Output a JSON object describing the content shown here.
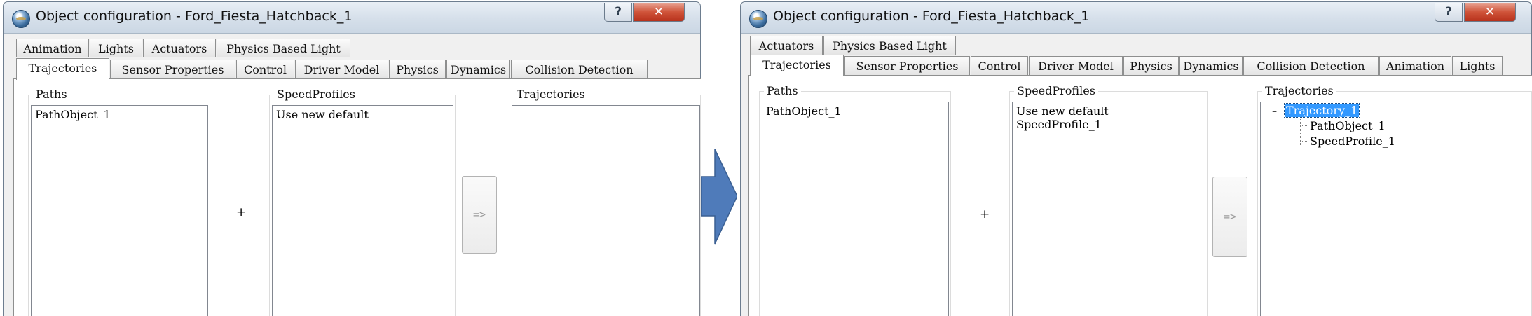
{
  "left": {
    "window_title": "Object configuration - Ford_Fiesta_Hatchback_1",
    "help_label": "?",
    "close_label": "✕",
    "tab_row_1": [
      "Animation",
      "Lights",
      "Actuators",
      "Physics Based Light"
    ],
    "tab_row_2": [
      "Trajectories",
      "Sensor Properties",
      "Control",
      "Driver Model",
      "Physics",
      "Dynamics",
      "Collision Detection"
    ],
    "paths": {
      "label": "Paths",
      "items": [
        "PathObject_1"
      ]
    },
    "speed_profiles": {
      "label": "SpeedProfiles",
      "items": [
        "Use new default"
      ]
    },
    "plus": "+",
    "assign_button": "=>",
    "trajectories": {
      "label": "Trajectories"
    }
  },
  "arrow_color": "#4f7bba",
  "right": {
    "window_title": "Object configuration - Ford_Fiesta_Hatchback_1",
    "help_label": "?",
    "close_label": "✕",
    "tab_row_1": [
      "Actuators",
      "Physics Based Light"
    ],
    "tab_row_2": [
      "Trajectories",
      "Sensor Properties",
      "Control",
      "Driver Model",
      "Physics",
      "Dynamics",
      "Collision Detection",
      "Animation",
      "Lights"
    ],
    "paths": {
      "label": "Paths",
      "items": [
        "PathObject_1"
      ]
    },
    "speed_profiles": {
      "label": "SpeedProfiles",
      "items": [
        "Use new default",
        "SpeedProfile_1"
      ]
    },
    "plus": "+",
    "assign_button": "=>",
    "trajectories": {
      "label": "Trajectories",
      "tree": {
        "toggle": "−",
        "root": "Trajectory_1",
        "children": [
          "PathObject_1",
          "SpeedProfile_1"
        ]
      }
    }
  }
}
